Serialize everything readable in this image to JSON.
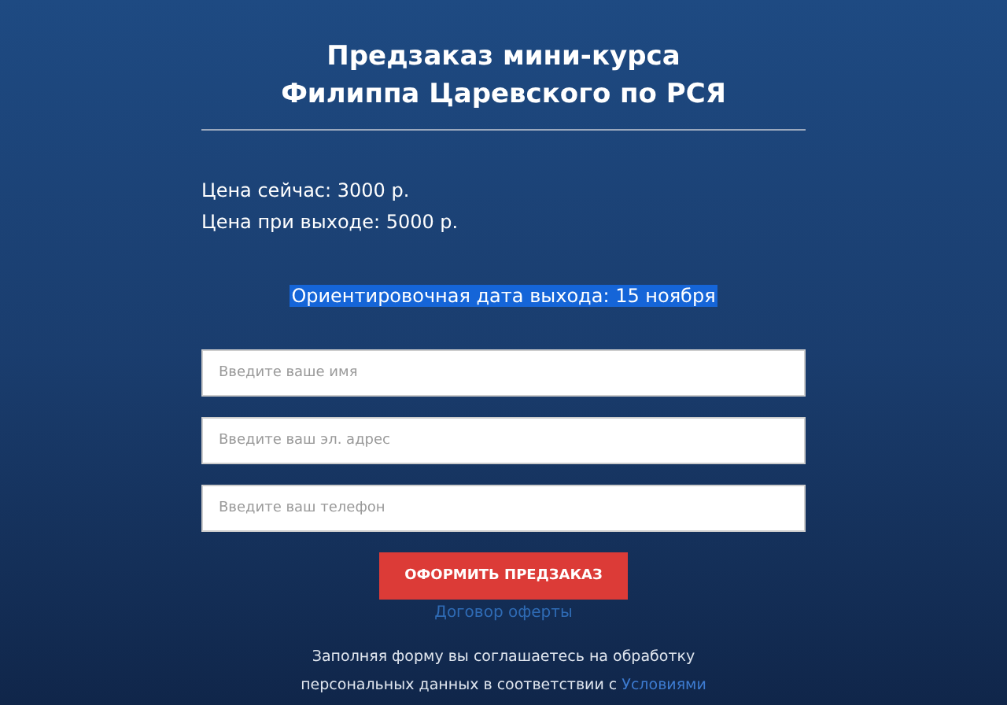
{
  "title": [
    "Предзаказ мини-курса",
    "Филиппа Царевского по РСЯ"
  ],
  "prices": [
    "Цена сейчас: 3000 р.",
    "Цена при выходе: 5000 р."
  ],
  "release_date": {
    "text": "Ориентировочная дата выхода: 15 ноября",
    "selected": true
  },
  "form": {
    "fields": [
      {
        "placeholder": "Введите ваше имя"
      },
      {
        "placeholder": "Введите ваш эл. адрес"
      },
      {
        "placeholder": "Введите ваш телефон"
      }
    ],
    "submit_button": "ОФОРМИТЬ ПРЕДЗАКАЗ",
    "offer_link": "Договор оферты"
  },
  "consent": {
    "text": "Заполняя форму вы соглашаетесь на обработку персональных данных в соответствии с",
    "link": "Условиями"
  }
}
